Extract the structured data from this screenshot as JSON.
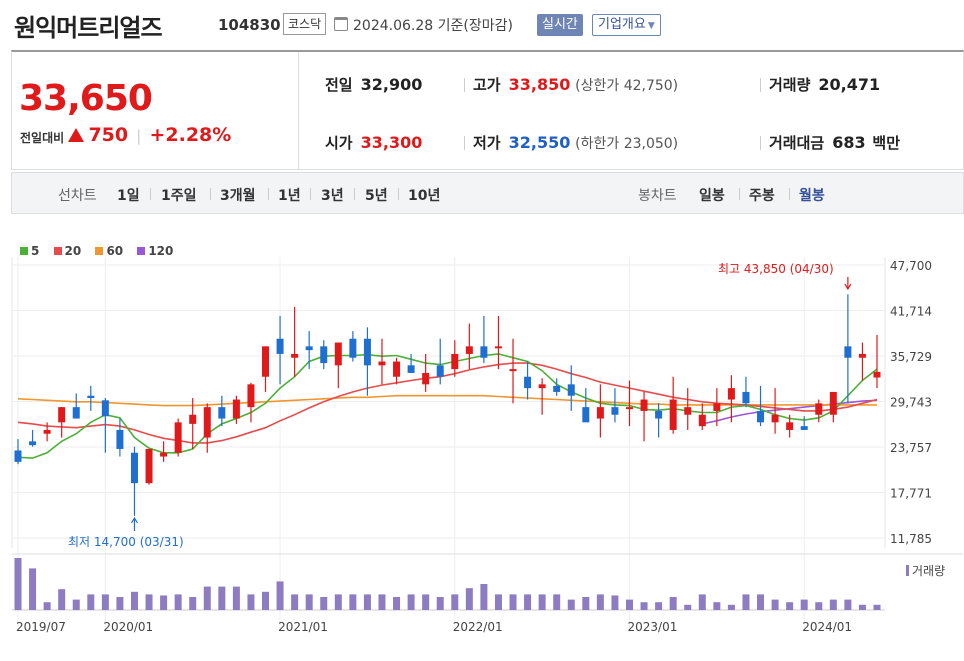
{
  "header": {
    "title": "원익머트리얼즈",
    "code": "104830",
    "market": "코스닥",
    "base_date": "2024.06.28 기준(장마감)",
    "realtime_label": "실시간",
    "company_label": "기업개요"
  },
  "quote": {
    "price": "33,650",
    "change_label": "전일대비",
    "change": "750",
    "change_pct": "+2.28%",
    "prev_close_label": "전일",
    "prev_close": "32,900",
    "open_label": "시가",
    "open": "33,300",
    "high_label": "고가",
    "high": "33,850",
    "upper_limit": "(상한가 42,750)",
    "low_label": "저가",
    "low": "32,550",
    "lower_limit": "(하한가 23,050)",
    "volume_label": "거래량",
    "volume": "20,471",
    "amount_label": "거래대금",
    "amount": "683",
    "amount_unit": "백만"
  },
  "periods": {
    "line_chart_label": "선차트",
    "line_items": [
      "1일",
      "1주일",
      "3개월",
      "1년",
      "3년",
      "5년",
      "10년"
    ],
    "candle_label": "봉차트",
    "candle_items": [
      "일봉",
      "주봉",
      "월봉"
    ]
  },
  "colors": {
    "up": "#e01a1a",
    "down": "#1f6fd1",
    "ma5": "#4caf37",
    "ma20": "#e74b4b",
    "ma60": "#f0962e",
    "ma120": "#9a58d6",
    "volume": "#8e7cc3"
  },
  "chart_data": {
    "type": "candlestick",
    "title": "",
    "ma_legend": [
      {
        "name": "5",
        "color": "#4caf37"
      },
      {
        "name": "20",
        "color": "#e74b4b"
      },
      {
        "name": "60",
        "color": "#f0962e"
      },
      {
        "name": "120",
        "color": "#9a58d6"
      }
    ],
    "y_ticks": [
      "47,700",
      "41,714",
      "35,729",
      "29,743",
      "23,757",
      "17,771",
      "11,785"
    ],
    "ylim": [
      11785,
      47700
    ],
    "x_tick_labels": [
      "2019/07",
      "2020/01",
      "2021/01",
      "2022/01",
      "2023/01",
      "2024/01"
    ],
    "annotation_high": "최고 43,850 (04/30)",
    "annotation_low": "최저 14,700 (03/31)",
    "volume_label": "거래량",
    "months": [
      "2019-07",
      "2019-08",
      "2019-09",
      "2019-10",
      "2019-11",
      "2019-12",
      "2020-01",
      "2020-02",
      "2020-03",
      "2020-04",
      "2020-05",
      "2020-06",
      "2020-07",
      "2020-08",
      "2020-09",
      "2020-10",
      "2020-11",
      "2020-12",
      "2021-01",
      "2021-02",
      "2021-03",
      "2021-04",
      "2021-05",
      "2021-06",
      "2021-07",
      "2021-08",
      "2021-09",
      "2021-10",
      "2021-11",
      "2021-12",
      "2022-01",
      "2022-02",
      "2022-03",
      "2022-04",
      "2022-05",
      "2022-06",
      "2022-07",
      "2022-08",
      "2022-09",
      "2022-10",
      "2022-11",
      "2022-12",
      "2023-01",
      "2023-02",
      "2023-03",
      "2023-04",
      "2023-05",
      "2023-06",
      "2023-07",
      "2023-08",
      "2023-09",
      "2023-10",
      "2023-11",
      "2023-12",
      "2024-01",
      "2024-02",
      "2024-03",
      "2024-04",
      "2024-05",
      "2024-06"
    ],
    "open": [
      23300,
      24500,
      25500,
      27000,
      29000,
      30500,
      29900,
      26000,
      23000,
      19000,
      22500,
      23000,
      26800,
      25000,
      29000,
      27500,
      29000,
      33000,
      38000,
      35500,
      37000,
      37000,
      34500,
      38000,
      38000,
      34500,
      33000,
      34500,
      32000,
      34500,
      34000,
      36000,
      37000,
      37000,
      34000,
      33000,
      31500,
      31800,
      32000,
      29000,
      27500,
      29000,
      29000,
      28500,
      28500,
      26000,
      28000,
      26500,
      28500,
      30000,
      31000,
      28500,
      27000,
      26000,
      26500,
      28000,
      28000,
      37000,
      35500,
      32900
    ],
    "high": [
      24800,
      26000,
      27000,
      29000,
      30800,
      31800,
      30200,
      27500,
      23800,
      23500,
      24500,
      27500,
      30200,
      29500,
      30500,
      30500,
      32200,
      37000,
      41000,
      42200,
      39000,
      37800,
      37500,
      39000,
      39500,
      38000,
      35500,
      36000,
      36000,
      38000,
      37800,
      40000,
      41000,
      41000,
      38000,
      35000,
      32800,
      32800,
      34500,
      31500,
      32000,
      31500,
      32500,
      31000,
      29500,
      33000,
      31500,
      29500,
      31500,
      33200,
      33000,
      31800,
      31500,
      28000,
      27800,
      30000,
      31000,
      43850,
      37500,
      38500
    ],
    "low": [
      21500,
      23800,
      24500,
      25000,
      27500,
      28500,
      23000,
      22500,
      14700,
      18800,
      21800,
      22500,
      23500,
      23000,
      26500,
      26800,
      27000,
      31000,
      32000,
      33000,
      34000,
      34000,
      31500,
      35000,
      30500,
      32000,
      32000,
      33500,
      31000,
      32000,
      33000,
      34000,
      34800,
      34000,
      29500,
      30000,
      28000,
      30500,
      28500,
      27500,
      25000,
      27000,
      26500,
      24500,
      25000,
      25500,
      26000,
      26000,
      26500,
      27000,
      29000,
      26500,
      25500,
      25000,
      26000,
      27000,
      27000,
      29500,
      32500,
      31500
    ],
    "close": [
      21800,
      24000,
      26000,
      29000,
      27500,
      30200,
      27800,
      23500,
      19000,
      23500,
      23000,
      27000,
      28000,
      29000,
      27500,
      30000,
      32000,
      37000,
      36000,
      36000,
      36500,
      34800,
      37500,
      35500,
      34500,
      35000,
      35000,
      33500,
      33500,
      33000,
      36000,
      37000,
      35500,
      37000,
      34000,
      31500,
      32000,
      31000,
      30500,
      27000,
      29000,
      28000,
      29000,
      30000,
      27500,
      30000,
      29000,
      28000,
      29500,
      31500,
      29500,
      27000,
      28000,
      27000,
      26000,
      29500,
      31000,
      35500,
      36000,
      33650
    ],
    "volume": [
      1.0,
      0.8,
      0.15,
      0.4,
      0.2,
      0.3,
      0.3,
      0.25,
      0.35,
      0.3,
      0.28,
      0.3,
      0.25,
      0.45,
      0.45,
      0.45,
      0.3,
      0.35,
      0.55,
      0.3,
      0.3,
      0.25,
      0.3,
      0.3,
      0.3,
      0.3,
      0.25,
      0.3,
      0.3,
      0.25,
      0.3,
      0.42,
      0.5,
      0.3,
      0.3,
      0.3,
      0.3,
      0.3,
      0.2,
      0.25,
      0.3,
      0.28,
      0.2,
      0.15,
      0.15,
      0.25,
      0.1,
      0.3,
      0.15,
      0.1,
      0.3,
      0.3,
      0.2,
      0.15,
      0.2,
      0.15,
      0.2,
      0.2,
      0.1,
      0.1
    ],
    "ma5": [
      22400,
      22300,
      23000,
      24500,
      25500,
      27000,
      28000,
      27600,
      25000,
      23600,
      23000,
      23000,
      23500,
      25500,
      26800,
      27500,
      28300,
      29500,
      31500,
      33000,
      35000,
      35700,
      35800,
      35800,
      35900,
      35700,
      35800,
      35300,
      34800,
      34600,
      35000,
      35400,
      35800,
      36000,
      35500,
      35000,
      33800,
      32000,
      31000,
      30200,
      29500,
      29300,
      29200,
      28700,
      28600,
      28800,
      28500,
      28300,
      28300,
      29000,
      29200,
      28700,
      28000,
      27500,
      27300,
      27600,
      28500,
      30500,
      32500,
      34000
    ],
    "ma20": [
      27000,
      26800,
      26500,
      26400,
      26300,
      26500,
      26700,
      26500,
      26000,
      25400,
      24900,
      24600,
      24300,
      24300,
      24600,
      25100,
      25700,
      26300,
      27200,
      28000,
      28900,
      29700,
      30400,
      31000,
      31500,
      31900,
      32200,
      32500,
      32800,
      33000,
      33400,
      33900,
      34300,
      34600,
      34800,
      34800,
      34500,
      34000,
      33400,
      32900,
      32300,
      31900,
      31500,
      31100,
      30700,
      30300,
      30000,
      29700,
      29500,
      29400,
      29300,
      29100,
      28900,
      28700,
      28500,
      28500,
      28700,
      29000,
      29500,
      30000
    ],
    "ma60": [
      30100,
      30000,
      29900,
      29800,
      29700,
      29700,
      29600,
      29500,
      29400,
      29300,
      29200,
      29200,
      29200,
      29300,
      29400,
      29500,
      29600,
      29700,
      29800,
      29900,
      30000,
      30100,
      30200,
      30300,
      30300,
      30400,
      30500,
      30500,
      30500,
      30500,
      30500,
      30500,
      30500,
      30400,
      30300,
      30200,
      30100,
      30000,
      29900,
      29800,
      29700,
      29600,
      29500,
      29400,
      29400,
      29300,
      29300,
      29300,
      29300,
      29300,
      29300,
      29300,
      29300,
      29300,
      29300,
      29300,
      29300,
      29300,
      29300,
      29300
    ],
    "ma120": [
      null,
      null,
      null,
      null,
      null,
      null,
      null,
      null,
      null,
      null,
      null,
      null,
      null,
      null,
      null,
      null,
      null,
      null,
      null,
      null,
      null,
      null,
      null,
      null,
      null,
      null,
      null,
      null,
      null,
      null,
      null,
      null,
      null,
      null,
      null,
      null,
      null,
      null,
      null,
      null,
      null,
      null,
      null,
      null,
      null,
      null,
      null,
      26800,
      27200,
      27700,
      28100,
      28400,
      28600,
      28800,
      29000,
      29200,
      29400,
      29600,
      29800,
      29900
    ]
  }
}
